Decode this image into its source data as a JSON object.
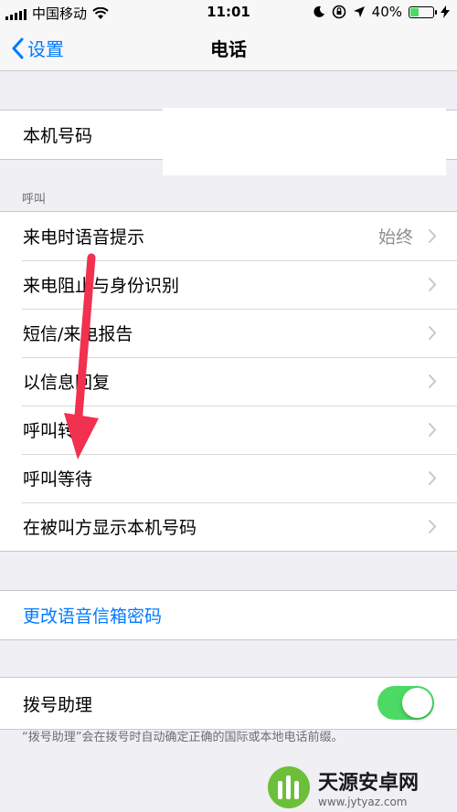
{
  "status": {
    "carrier": "中国移动",
    "time": "11:01",
    "battery": "40%",
    "battery_level": 0.4
  },
  "nav": {
    "back_label": "设置",
    "title": "电话"
  },
  "group_phone": {
    "my_number_label": "本机号码"
  },
  "calls_section": {
    "header": "呼叫",
    "rows": [
      {
        "label": "来电时语音提示",
        "value": "始终"
      },
      {
        "label": "来电阻止与身份识别",
        "value": ""
      },
      {
        "label": "短信/来电报告",
        "value": ""
      },
      {
        "label": "以信息回复",
        "value": ""
      },
      {
        "label": "呼叫转移",
        "value": ""
      },
      {
        "label": "呼叫等待",
        "value": ""
      },
      {
        "label": "在被叫方显示本机号码",
        "value": ""
      }
    ]
  },
  "voicemail": {
    "change_password": "更改语音信箱密码"
  },
  "dial_assist": {
    "label": "拨号助理",
    "enabled": true,
    "footnote": "“拨号助理”会在拨号时自动确定正确的国际或本地电话前缀。"
  },
  "watermark": {
    "name": "天源安卓网",
    "url": "www.jytyaz.com"
  },
  "colors": {
    "accent": "#007aff",
    "toggle_on": "#4cd964",
    "arrow": "#f2304f"
  }
}
